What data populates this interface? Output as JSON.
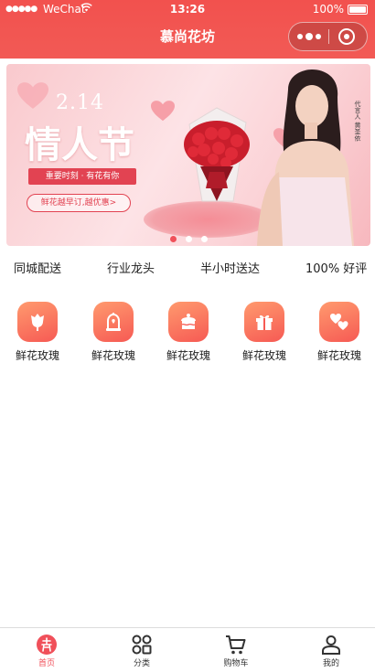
{
  "status_bar": {
    "signal": "●●●●●",
    "carrier": "WeChat",
    "wifi_icon": "wifi-icon",
    "time": "13:26",
    "battery": "100%"
  },
  "nav": {
    "title": "慕尚花坊",
    "capsule_more_icon": "more-dots-icon",
    "capsule_close_icon": "target-close-icon"
  },
  "banner": {
    "date": "2.14",
    "title": "情人节",
    "ribbon": "重要时刻 · 有花有你",
    "pill": "鲜花越早订,越优惠>",
    "sign": "代言人 黄圣依",
    "slide_count": 3,
    "active_slide": 1
  },
  "features": [
    "同城配送",
    "行业龙头",
    "半小时送达",
    "100% 好评"
  ],
  "categories": [
    {
      "label": "鲜花玫瑰",
      "icon": "flower-icon"
    },
    {
      "label": "鲜花玫瑰",
      "icon": "bell-jar-icon"
    },
    {
      "label": "鲜花玫瑰",
      "icon": "cake-icon"
    },
    {
      "label": "鲜花玫瑰",
      "icon": "gift-icon"
    },
    {
      "label": "鲜花玫瑰",
      "icon": "hearts-icon"
    }
  ],
  "tabbar": {
    "items": [
      {
        "label": "首页",
        "icon": "home-flower-icon",
        "active": true
      },
      {
        "label": "分类",
        "icon": "grid-icon",
        "active": false
      },
      {
        "label": "购物车",
        "icon": "cart-icon",
        "active": false
      },
      {
        "label": "我的",
        "icon": "user-icon",
        "active": false
      }
    ]
  },
  "colors": {
    "brand": "#f2514e",
    "active_tab": "#f0505a",
    "icon_gradient_start": "#ff9a6e",
    "icon_gradient_end": "#f65a54"
  }
}
